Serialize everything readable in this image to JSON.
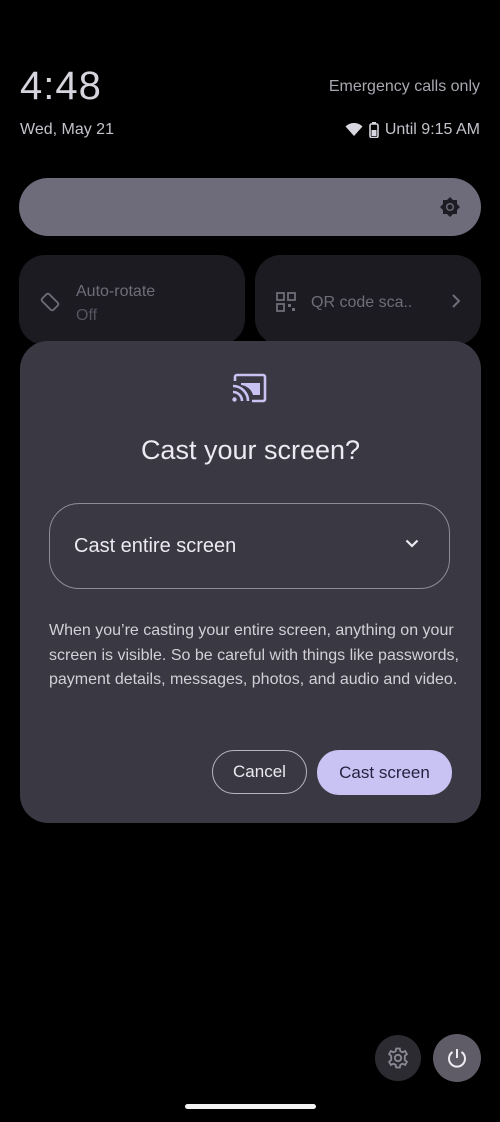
{
  "status": {
    "time": "4:48",
    "date": "Wed, May 21",
    "carrier": "Emergency calls only",
    "battery_text": "Until 9:15 AM"
  },
  "quick_settings": {
    "tiles": [
      {
        "title": "Auto-rotate",
        "subtitle": "Off"
      },
      {
        "title": "QR code sca.."
      }
    ]
  },
  "dialog": {
    "title": "Cast your screen?",
    "dropdown_value": "Cast entire screen",
    "description": "When you’re casting your entire screen, anything on your screen is visible. So be careful with things like passwords, payment details, messages, photos, and audio and video.",
    "cancel_label": "Cancel",
    "confirm_label": "Cast screen"
  },
  "colors": {
    "dialog_bg": "#3a3842",
    "primary_button": "#c9c3f4",
    "brightness_slider": "#6e6b7a"
  }
}
